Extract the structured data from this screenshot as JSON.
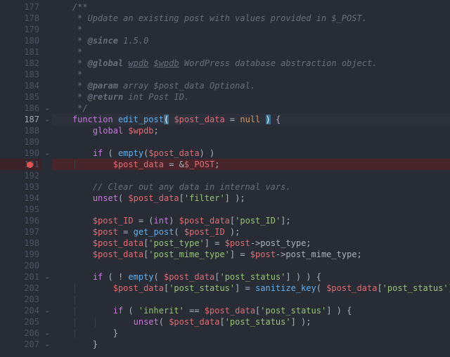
{
  "editor": {
    "first_line": 177,
    "current_line": 187,
    "breakpoints": [
      191
    ],
    "lines": [
      {
        "n": 177,
        "fold": "",
        "tokens": [
          {
            "t": "    ",
            "c": "indent"
          },
          {
            "t": "/**",
            "c": "comment"
          }
        ]
      },
      {
        "n": 178,
        "fold": "",
        "tokens": [
          {
            "t": "    ",
            "c": "indent"
          },
          {
            "t": " * Update an existing post with values provided in $_POST.",
            "c": "comment"
          }
        ]
      },
      {
        "n": 179,
        "fold": "",
        "tokens": [
          {
            "t": "    ",
            "c": "indent"
          },
          {
            "t": " *",
            "c": "comment"
          }
        ]
      },
      {
        "n": 180,
        "fold": "",
        "tokens": [
          {
            "t": "    ",
            "c": "indent"
          },
          {
            "t": " * ",
            "c": "comment"
          },
          {
            "t": "@since",
            "c": "doctag"
          },
          {
            "t": " 1.5.0",
            "c": "comment"
          }
        ]
      },
      {
        "n": 181,
        "fold": "",
        "tokens": [
          {
            "t": "    ",
            "c": "indent"
          },
          {
            "t": " *",
            "c": "comment"
          }
        ]
      },
      {
        "n": 182,
        "fold": "",
        "tokens": [
          {
            "t": "    ",
            "c": "indent"
          },
          {
            "t": " * ",
            "c": "comment"
          },
          {
            "t": "@global",
            "c": "doctag"
          },
          {
            "t": " ",
            "c": "comment"
          },
          {
            "t": "wpdb",
            "c": "doctype"
          },
          {
            "t": " ",
            "c": "comment"
          },
          {
            "t": "$wpdb",
            "c": "doctype"
          },
          {
            "t": " WordPress database abstraction object.",
            "c": "comment"
          }
        ]
      },
      {
        "n": 183,
        "fold": "",
        "tokens": [
          {
            "t": "    ",
            "c": "indent"
          },
          {
            "t": " *",
            "c": "comment"
          }
        ]
      },
      {
        "n": 184,
        "fold": "",
        "tokens": [
          {
            "t": "    ",
            "c": "indent"
          },
          {
            "t": " * ",
            "c": "comment"
          },
          {
            "t": "@param",
            "c": "doctag"
          },
          {
            "t": " array $post_data Optional.",
            "c": "comment"
          }
        ]
      },
      {
        "n": 185,
        "fold": "",
        "tokens": [
          {
            "t": "    ",
            "c": "indent"
          },
          {
            "t": " * ",
            "c": "comment"
          },
          {
            "t": "@return",
            "c": "doctag"
          },
          {
            "t": " int Post ID.",
            "c": "comment"
          }
        ]
      },
      {
        "n": 186,
        "fold": "⌄",
        "tokens": [
          {
            "t": "    ",
            "c": "indent"
          },
          {
            "t": " */",
            "c": "comment"
          }
        ]
      },
      {
        "n": 187,
        "fold": "⌄",
        "tokens": [
          {
            "t": "    ",
            "c": "indent"
          },
          {
            "t": "function ",
            "c": "keyword"
          },
          {
            "t": "edit_post",
            "c": "func"
          },
          {
            "t": "(",
            "c": "punct",
            "paren": true
          },
          {
            "t": " ",
            "c": "punct"
          },
          {
            "t": "$post_data",
            "c": "var"
          },
          {
            "t": " = ",
            "c": "punct"
          },
          {
            "t": "null",
            "c": "const"
          },
          {
            "t": " ",
            "c": "punct"
          },
          {
            "t": ")",
            "c": "punct",
            "paren": true
          },
          {
            "t": " {",
            "c": "punct"
          }
        ]
      },
      {
        "n": 188,
        "fold": "",
        "tokens": [
          {
            "t": "    ",
            "c": "indent"
          },
          {
            "t": "    ",
            "c": "indent"
          },
          {
            "t": "global ",
            "c": "keyword"
          },
          {
            "t": "$wpdb",
            "c": "var"
          },
          {
            "t": ";",
            "c": "punct"
          }
        ]
      },
      {
        "n": 189,
        "fold": "",
        "tokens": []
      },
      {
        "n": 190,
        "fold": "⌄",
        "tokens": [
          {
            "t": "    ",
            "c": "indent"
          },
          {
            "t": "    ",
            "c": "indent"
          },
          {
            "t": "if ",
            "c": "keyword"
          },
          {
            "t": "( ",
            "c": "punct"
          },
          {
            "t": "empty",
            "c": "func"
          },
          {
            "t": "(",
            "c": "punct"
          },
          {
            "t": "$post_data",
            "c": "var"
          },
          {
            "t": ") )",
            "c": "punct"
          }
        ]
      },
      {
        "n": 191,
        "fold": "",
        "tokens": [
          {
            "t": "    ",
            "c": "indent"
          },
          {
            "t": "|   ",
            "c": "indent"
          },
          {
            "t": "    ",
            "c": "indent"
          },
          {
            "t": "$post_data",
            "c": "var"
          },
          {
            "t": " = &",
            "c": "punct"
          },
          {
            "t": "$_POST",
            "c": "var"
          },
          {
            "t": ";",
            "c": "punct"
          }
        ]
      },
      {
        "n": 192,
        "fold": "",
        "tokens": []
      },
      {
        "n": 193,
        "fold": "",
        "tokens": [
          {
            "t": "    ",
            "c": "indent"
          },
          {
            "t": "    ",
            "c": "indent"
          },
          {
            "t": "// Clear out any data in internal vars.",
            "c": "comment"
          }
        ]
      },
      {
        "n": 194,
        "fold": "",
        "tokens": [
          {
            "t": "    ",
            "c": "indent"
          },
          {
            "t": "    ",
            "c": "indent"
          },
          {
            "t": "unset",
            "c": "keyword"
          },
          {
            "t": "( ",
            "c": "punct"
          },
          {
            "t": "$post_data",
            "c": "var"
          },
          {
            "t": "[",
            "c": "punct"
          },
          {
            "t": "'filter'",
            "c": "str"
          },
          {
            "t": "] );",
            "c": "punct"
          }
        ]
      },
      {
        "n": 195,
        "fold": "",
        "tokens": []
      },
      {
        "n": 196,
        "fold": "",
        "tokens": [
          {
            "t": "    ",
            "c": "indent"
          },
          {
            "t": "    ",
            "c": "indent"
          },
          {
            "t": "$post_ID",
            "c": "var"
          },
          {
            "t": " = (",
            "c": "punct"
          },
          {
            "t": "int",
            "c": "keyword"
          },
          {
            "t": ") ",
            "c": "punct"
          },
          {
            "t": "$post_data",
            "c": "var"
          },
          {
            "t": "[",
            "c": "punct"
          },
          {
            "t": "'post_ID'",
            "c": "str"
          },
          {
            "t": "];",
            "c": "punct"
          }
        ]
      },
      {
        "n": 197,
        "fold": "",
        "tokens": [
          {
            "t": "    ",
            "c": "indent"
          },
          {
            "t": "    ",
            "c": "indent"
          },
          {
            "t": "$post",
            "c": "var"
          },
          {
            "t": " = ",
            "c": "punct"
          },
          {
            "t": "get_post",
            "c": "func"
          },
          {
            "t": "( ",
            "c": "punct"
          },
          {
            "t": "$post_ID",
            "c": "var"
          },
          {
            "t": " );",
            "c": "punct"
          }
        ]
      },
      {
        "n": 198,
        "fold": "",
        "tokens": [
          {
            "t": "    ",
            "c": "indent"
          },
          {
            "t": "    ",
            "c": "indent"
          },
          {
            "t": "$post_data",
            "c": "var"
          },
          {
            "t": "[",
            "c": "punct"
          },
          {
            "t": "'post_type'",
            "c": "str"
          },
          {
            "t": "] = ",
            "c": "punct"
          },
          {
            "t": "$post",
            "c": "var"
          },
          {
            "t": "->",
            "c": "punct"
          },
          {
            "t": "post_type",
            "c": "prop"
          },
          {
            "t": ";",
            "c": "punct"
          }
        ]
      },
      {
        "n": 199,
        "fold": "",
        "tokens": [
          {
            "t": "    ",
            "c": "indent"
          },
          {
            "t": "    ",
            "c": "indent"
          },
          {
            "t": "$post_data",
            "c": "var"
          },
          {
            "t": "[",
            "c": "punct"
          },
          {
            "t": "'post_mime_type'",
            "c": "str"
          },
          {
            "t": "] = ",
            "c": "punct"
          },
          {
            "t": "$post",
            "c": "var"
          },
          {
            "t": "->",
            "c": "punct"
          },
          {
            "t": "post_mime_type",
            "c": "prop"
          },
          {
            "t": ";",
            "c": "punct"
          }
        ]
      },
      {
        "n": 200,
        "fold": "",
        "tokens": []
      },
      {
        "n": 201,
        "fold": "⌄",
        "tokens": [
          {
            "t": "    ",
            "c": "indent"
          },
          {
            "t": "    ",
            "c": "indent"
          },
          {
            "t": "if ",
            "c": "keyword"
          },
          {
            "t": "( ! ",
            "c": "punct"
          },
          {
            "t": "empty",
            "c": "func"
          },
          {
            "t": "( ",
            "c": "punct"
          },
          {
            "t": "$post_data",
            "c": "var"
          },
          {
            "t": "[",
            "c": "punct"
          },
          {
            "t": "'post_status'",
            "c": "str"
          },
          {
            "t": "] ) ) {",
            "c": "punct"
          }
        ]
      },
      {
        "n": 202,
        "fold": "",
        "tokens": [
          {
            "t": "    ",
            "c": "indent"
          },
          {
            "t": "|   ",
            "c": "indent"
          },
          {
            "t": "    ",
            "c": "indent"
          },
          {
            "t": "$post_data",
            "c": "var"
          },
          {
            "t": "[",
            "c": "punct"
          },
          {
            "t": "'post_status'",
            "c": "str"
          },
          {
            "t": "] = ",
            "c": "punct"
          },
          {
            "t": "sanitize_key",
            "c": "func"
          },
          {
            "t": "( ",
            "c": "punct"
          },
          {
            "t": "$post_data",
            "c": "var"
          },
          {
            "t": "[",
            "c": "punct"
          },
          {
            "t": "'post_status'",
            "c": "str"
          },
          {
            "t": "] );",
            "c": "punct"
          }
        ]
      },
      {
        "n": 203,
        "fold": "",
        "tokens": [
          {
            "t": "    ",
            "c": "indent"
          },
          {
            "t": "|",
            "c": "indent"
          }
        ]
      },
      {
        "n": 204,
        "fold": "⌄",
        "tokens": [
          {
            "t": "    ",
            "c": "indent"
          },
          {
            "t": "|   ",
            "c": "indent"
          },
          {
            "t": "    ",
            "c": "indent"
          },
          {
            "t": "if ",
            "c": "keyword"
          },
          {
            "t": "( ",
            "c": "punct"
          },
          {
            "t": "'inherit'",
            "c": "str"
          },
          {
            "t": " == ",
            "c": "punct"
          },
          {
            "t": "$post_data",
            "c": "var"
          },
          {
            "t": "[",
            "c": "punct"
          },
          {
            "t": "'post_status'",
            "c": "str"
          },
          {
            "t": "] ) {",
            "c": "punct"
          }
        ]
      },
      {
        "n": 205,
        "fold": "",
        "tokens": [
          {
            "t": "    ",
            "c": "indent"
          },
          {
            "t": "|   ",
            "c": "indent"
          },
          {
            "t": "|   ",
            "c": "indent"
          },
          {
            "t": "    ",
            "c": "indent"
          },
          {
            "t": "unset",
            "c": "keyword"
          },
          {
            "t": "( ",
            "c": "punct"
          },
          {
            "t": "$post_data",
            "c": "var"
          },
          {
            "t": "[",
            "c": "punct"
          },
          {
            "t": "'post_status'",
            "c": "str"
          },
          {
            "t": "] );",
            "c": "punct"
          }
        ]
      },
      {
        "n": 206,
        "fold": "⌄",
        "tokens": [
          {
            "t": "    ",
            "c": "indent"
          },
          {
            "t": "|   ",
            "c": "indent"
          },
          {
            "t": "    ",
            "c": "indent"
          },
          {
            "t": "}",
            "c": "punct"
          }
        ]
      },
      {
        "n": 207,
        "fold": "⌄",
        "tokens": [
          {
            "t": "    ",
            "c": "indent"
          },
          {
            "t": "    ",
            "c": "indent"
          },
          {
            "t": "}",
            "c": "punct"
          }
        ]
      }
    ]
  }
}
